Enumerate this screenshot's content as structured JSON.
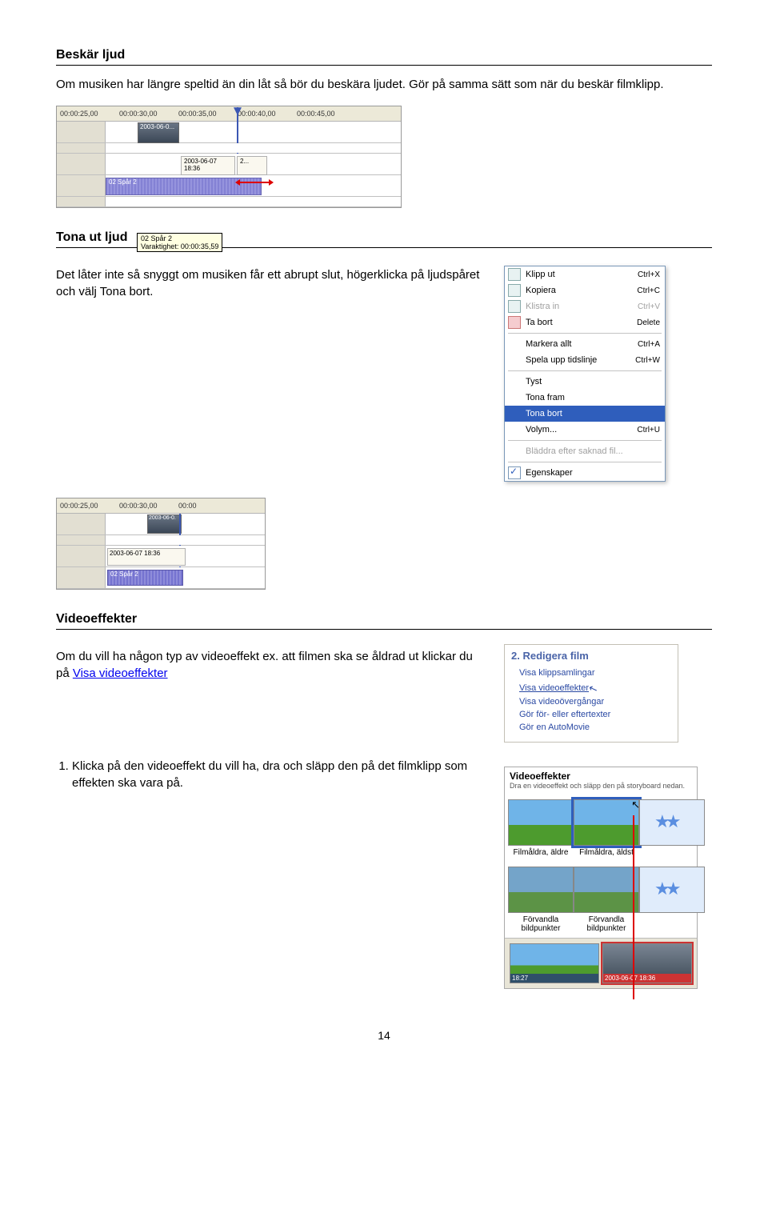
{
  "section1": {
    "title": "Beskär ljud",
    "body": "Om musiken har längre speltid än din låt så bör du beskära ljudet. Gör på samma sätt som när du beskär filmklipp."
  },
  "shot1": {
    "ruler": [
      "00:00:25,00",
      "00:00:30,00",
      "00:00:35,00",
      "00:00:40,00",
      "00:00:45,00"
    ],
    "clipLabel": "2003-06-0...",
    "caption1": "2003-06-07 18:36",
    "caption2": "2...",
    "audioLabel": "02 Spår 2",
    "tooltip1": "02 Spår 2",
    "tooltip2": "Varaktighet: 00:00:35,59"
  },
  "section2": {
    "title": "Tona ut ljud",
    "body": "Det låter inte så snyggt om musiken får ett abrupt slut, högerklicka på ljudspåret och välj Tona bort."
  },
  "shot2": {
    "ruler": [
      "00:00:25,00",
      "00:00:30,00",
      "00:00"
    ],
    "clipLabel": "2003-06-0.",
    "caption": "2003-06-07 18:36",
    "audioLabel": "02 Spår 2"
  },
  "ctx": {
    "items": [
      {
        "label": "Klipp ut",
        "short": "Ctrl+X",
        "icon": true
      },
      {
        "label": "Kopiera",
        "short": "Ctrl+C",
        "icon": true
      },
      {
        "label": "Klistra in",
        "short": "Ctrl+V",
        "disabled": true,
        "icon": true
      },
      {
        "label": "Ta bort",
        "short": "Delete",
        "iconRed": true
      }
    ],
    "items2": [
      {
        "label": "Markera allt",
        "short": "Ctrl+A"
      },
      {
        "label": "Spela upp tidslinje",
        "short": "Ctrl+W"
      }
    ],
    "items3": [
      {
        "label": "Tyst"
      },
      {
        "label": "Tona fram"
      },
      {
        "label": "Tona bort",
        "sel": true
      },
      {
        "label": "Volym...",
        "short": "Ctrl+U"
      }
    ],
    "items4": [
      {
        "label": "Bläddra efter saknad fil...",
        "disabled": true
      }
    ],
    "items5": [
      {
        "label": "Egenskaper",
        "check": true
      }
    ]
  },
  "section3": {
    "title": "Videoeffekter",
    "body_before": "Om du vill ha någon typ av videoeffekt ex. att filmen ska se åldrad ut klickar du på ",
    "link": "Visa videoeffekter"
  },
  "panel": {
    "head": "2. Redigera film",
    "links": [
      "Visa klippsamlingar",
      "Visa videoeffekter",
      "Visa videoövergångar",
      "Gör för- eller eftertexter",
      "Gör en AutoMovie"
    ]
  },
  "list": {
    "item1": "Klicka på den videoeffekt du vill ha, dra och släpp den på det filmklipp som effekten ska vara på."
  },
  "gallery": {
    "head": "Videoeffekter",
    "sub": "Dra en videoeffekt och släpp den på storyboard nedan.",
    "t1": "Filmåldra, äldre",
    "t2": "Filmåldra, äldst",
    "t3": "Förvandla bildpunkter",
    "t4": "Förvandla bildpunkter",
    "s1": "18:27",
    "s2": "2003-06-07 18:36"
  },
  "page": "14"
}
